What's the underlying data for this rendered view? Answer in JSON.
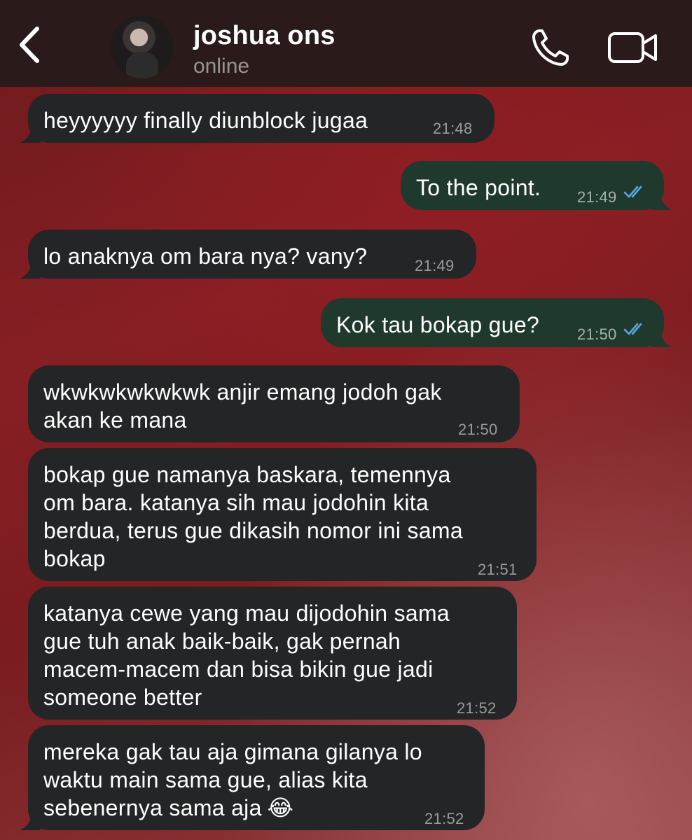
{
  "header": {
    "contact_name": "joshua ons",
    "status": "online",
    "back_icon": "chevron-left-icon",
    "call_icon": "phone-icon",
    "video_icon": "video-camera-icon",
    "background_color": "#2a1a1a"
  },
  "colors": {
    "incoming_bubble": "#232526",
    "outgoing_bubble": "#1f3a2c",
    "read_ticks": "#5aa8e8",
    "wallpaper": "#7a1c20"
  },
  "messages": [
    {
      "direction": "in",
      "text": "heyyyyyy finally diunblock jugaa",
      "time": "21:48"
    },
    {
      "direction": "out",
      "text": "To the point.",
      "time": "21:49",
      "status": "read"
    },
    {
      "direction": "in",
      "text": "lo anaknya om bara nya? vany?",
      "time": "21:49"
    },
    {
      "direction": "out",
      "text": "Kok tau bokap gue?",
      "time": "21:50",
      "status": "read"
    },
    {
      "direction": "in",
      "text": "wkwkwkwkwkwk anjir emang jodoh gak\nakan ke mana",
      "time": "21:50"
    },
    {
      "direction": "in",
      "text": "bokap gue namanya baskara, temennya\nom bara. katanya sih mau jodohin kita\nberdua, terus gue dikasih nomor ini sama\nbokap",
      "time": "21:51"
    },
    {
      "direction": "in",
      "text": "katanya cewe yang mau dijodohin sama\ngue tuh anak baik-baik, gak pernah\nmacem-macem dan bisa bikin gue jadi\nsomeone better",
      "time": "21:52"
    },
    {
      "direction": "in",
      "text": "mereka gak tau aja gimana gilanya lo\nwaktu main sama gue, alias kita\nsebenernya sama aja",
      "emoji": "😂",
      "time": "21:52"
    }
  ]
}
